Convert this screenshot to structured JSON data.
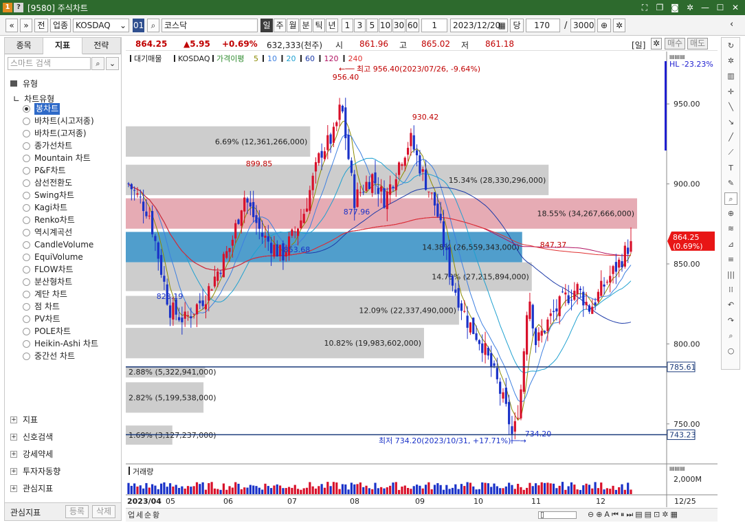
{
  "window": {
    "title": "[9580] 주식차트",
    "badge_one": "1",
    "badge_help": "?"
  },
  "toolbar": {
    "prev": "«",
    "next": "»",
    "btn_all": "전",
    "btn_sector": "업종",
    "market_select": "KOSDAQ",
    "code": "01",
    "name": "코스닥",
    "periods": [
      "일",
      "주",
      "월",
      "분",
      "틱",
      "년"
    ],
    "intervals": [
      "1",
      "3",
      "5",
      "10",
      "30",
      "60"
    ],
    "unit_value": "1",
    "date": "2023/12/20",
    "count_label": "당",
    "count": "170",
    "slash": "/",
    "total": "3000"
  },
  "left": {
    "tabs": [
      "종목",
      "지표",
      "전략"
    ],
    "active_tab": "지표",
    "search_placeholder": "스마트 검색",
    "section": "유형",
    "subsection": "차트유형",
    "chart_types": [
      "봉차트",
      "바차트(시고저종)",
      "바차트(고저종)",
      "종가선차트",
      "Mountain 차트",
      "P&F차트",
      "삼선전환도",
      "Swing차트",
      "Kagi차트",
      "Renko차트",
      "역시계곡선",
      "CandleVolume",
      "EquiVolume",
      "FLOW차트",
      "분산형차트",
      "계단 차트",
      "점 차트",
      "PV차트",
      "POLE차트",
      "Heikin-Ashi 차트",
      "중간선 차트"
    ],
    "selected_type": "봉차트",
    "groups": [
      "지표",
      "신호검색",
      "강세약세",
      "투자자동향",
      "관심지표"
    ],
    "bottom_label": "관심지표",
    "bottom_btn_register": "등록",
    "bottom_btn_delete": "삭제"
  },
  "info": {
    "price": "864.25",
    "change": "▲5.95",
    "change_pct": "+0.69%",
    "volume": "632,333(천주)",
    "open_label": "시",
    "open": "861.96",
    "high_label": "고",
    "high": "865.02",
    "low_label": "저",
    "low": "861.18",
    "period_tag": "[일]",
    "buy": "매수",
    "sell": "매도"
  },
  "chart_data": {
    "type": "candlestick",
    "legend": {
      "volume_profile": "대기매물",
      "symbol": "KOSDAQ",
      "ma_label": "가격이평",
      "ma_periods": [
        "5",
        "10",
        "20",
        "60",
        "120",
        "240"
      ]
    },
    "ma_colors": [
      "#8a8a00",
      "#3d7fe0",
      "#1ea0d0",
      "#1c3aa8",
      "#b01060",
      "#e03030"
    ],
    "y_axis": {
      "min": 725,
      "max": 975,
      "ticks": [
        "950.00",
        "900.00",
        "850.00",
        "800.00",
        "750.00"
      ]
    },
    "x_axis": {
      "labels": [
        "2023/04",
        "05",
        "06",
        "07",
        "08",
        "09",
        "10",
        "11",
        "12",
        "12/25"
      ]
    },
    "hl_label": "HL -23.23%",
    "current_price_tag": "864.25",
    "current_pct_tag": "(0.69%)",
    "horizontal_lines": [
      {
        "value": 785.61,
        "label": "785.61"
      },
      {
        "value": 743.23,
        "label": "743.23"
      }
    ],
    "annotations": {
      "max_label": "최고 956.40(2023/07/26, -9.64%)",
      "min_label": "최저 734.20(2023/10/31, +17.71%)",
      "peaks": [
        {
          "value": 956.4,
          "label": "956.40"
        },
        {
          "value": 930.42,
          "label": "930.42"
        },
        {
          "value": 899.85,
          "label": "899.85"
        },
        {
          "value": 847.37,
          "label": "847.37"
        },
        {
          "value": 877.96,
          "label": "877.96"
        },
        {
          "value": 853.68,
          "label": "853.68"
        },
        {
          "value": 823.19,
          "label": "823.19"
        },
        {
          "value": 734.2,
          "label": "734.20"
        }
      ]
    },
    "volume_profile_bars": [
      {
        "label": "6.69% (12,361,266,000)",
        "pct": 6.69
      },
      {
        "label": "15.34% (28,330,296,000)",
        "pct": 15.34
      },
      {
        "label": "18.55% (34,267,666,000)",
        "pct": 18.55
      },
      {
        "label": "14.38% (26,559,343,000)",
        "pct": 14.38
      },
      {
        "label": "14.73% (27,215,894,000)",
        "pct": 14.73
      },
      {
        "label": "12.09% (22,337,490,000)",
        "pct": 12.09
      },
      {
        "label": "10.82% (19,983,602,000)",
        "pct": 10.82
      },
      {
        "label": "2.88% (5,322,941,000)",
        "pct": 2.88
      },
      {
        "label": "2.82% (5,199,538,000)",
        "pct": 2.82
      },
      {
        "label": "1.69% (3,127,237,000)",
        "pct": 1.69
      }
    ],
    "volume_panel": {
      "title": "거래량",
      "tick": "2,000M"
    }
  },
  "bottom": {
    "buttons": [
      "업",
      "세",
      "순",
      "황"
    ]
  }
}
